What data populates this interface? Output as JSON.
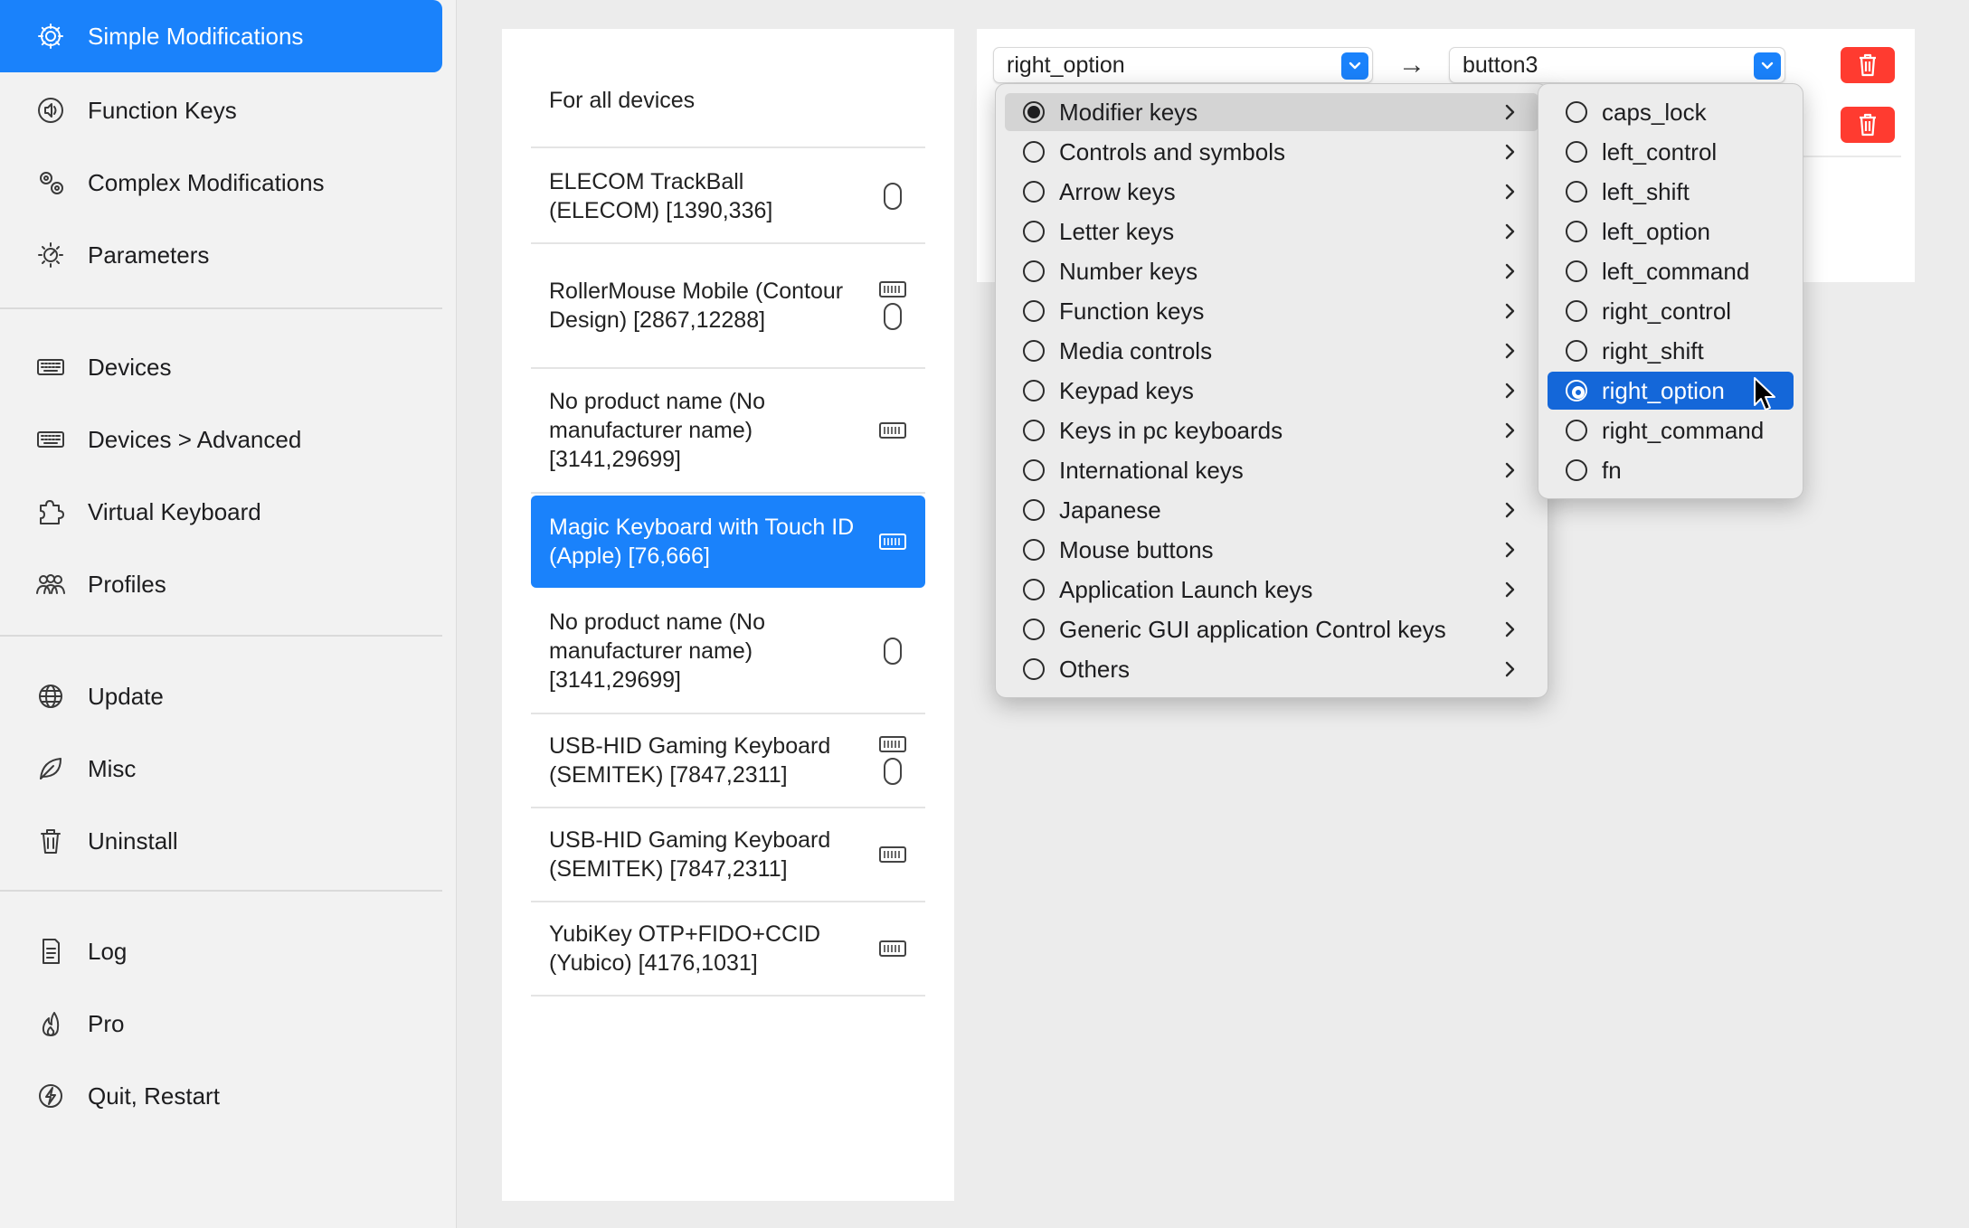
{
  "sidebar": {
    "items": [
      {
        "label": "Simple Modifications",
        "icon": "gear-icon",
        "active": true
      },
      {
        "label": "Function Keys",
        "icon": "speaker-icon"
      },
      {
        "label": "Complex Modifications",
        "icon": "gears-icon"
      },
      {
        "label": "Parameters",
        "icon": "sun-dial-icon"
      },
      {
        "label": "Devices",
        "icon": "keyboard-icon"
      },
      {
        "label": "Devices > Advanced",
        "icon": "keyboard-icon"
      },
      {
        "label": "Virtual Keyboard",
        "icon": "puzzle-icon"
      },
      {
        "label": "Profiles",
        "icon": "people-icon"
      },
      {
        "label": "Update",
        "icon": "globe-icon"
      },
      {
        "label": "Misc",
        "icon": "leaf-icon"
      },
      {
        "label": "Uninstall",
        "icon": "trash-icon"
      },
      {
        "label": "Log",
        "icon": "document-icon"
      },
      {
        "label": "Pro",
        "icon": "flame-icon"
      },
      {
        "label": "Quit, Restart",
        "icon": "bolt-icon"
      }
    ]
  },
  "devices": {
    "items": [
      {
        "name": "For all devices",
        "icons": []
      },
      {
        "name": "ELECOM TrackBall (ELECOM) [1390,336]",
        "icons": [
          "mouse-icon"
        ]
      },
      {
        "name": "RollerMouse Mobile (Contour Design) [2867,12288]",
        "icons": [
          "keyboard-icon",
          "mouse-icon"
        ]
      },
      {
        "name": "No product name (No manufacturer name) [3141,29699]",
        "icons": [
          "keyboard-icon"
        ]
      },
      {
        "name": "Magic Keyboard with Touch ID (Apple) [76,666]",
        "icons": [
          "keyboard-icon"
        ],
        "selected": true
      },
      {
        "name": "No product name (No manufacturer name) [3141,29699]",
        "icons": [
          "mouse-icon"
        ]
      },
      {
        "name": "USB-HID Gaming Keyboard (SEMITEK) [7847,2311]",
        "icons": [
          "keyboard-icon",
          "mouse-icon"
        ]
      },
      {
        "name": "USB-HID Gaming Keyboard (SEMITEK) [7847,2311]",
        "icons": [
          "keyboard-icon"
        ]
      },
      {
        "name": "YubiKey OTP+FIDO+CCID (Yubico) [4176,1031]",
        "icons": [
          "keyboard-icon"
        ]
      }
    ]
  },
  "mapping": {
    "from_value": "right_option",
    "to_value": "button3",
    "arrow": "→"
  },
  "category_menu": {
    "items": [
      {
        "label": "Modifier keys",
        "checked": true,
        "hover": true
      },
      {
        "label": "Controls and symbols"
      },
      {
        "label": "Arrow keys"
      },
      {
        "label": "Letter keys"
      },
      {
        "label": "Number keys"
      },
      {
        "label": "Function keys"
      },
      {
        "label": "Media controls"
      },
      {
        "label": "Keypad keys"
      },
      {
        "label": "Keys in pc keyboards"
      },
      {
        "label": "International keys"
      },
      {
        "label": "Japanese"
      },
      {
        "label": "Mouse buttons"
      },
      {
        "label": "Application Launch keys"
      },
      {
        "label": "Generic GUI application Control keys"
      },
      {
        "label": "Others"
      }
    ]
  },
  "modifier_menu": {
    "items": [
      {
        "label": "caps_lock"
      },
      {
        "label": "left_control"
      },
      {
        "label": "left_shift"
      },
      {
        "label": "left_option"
      },
      {
        "label": "left_command"
      },
      {
        "label": "right_control"
      },
      {
        "label": "right_shift"
      },
      {
        "label": "right_option",
        "checked": true,
        "selected": true
      },
      {
        "label": "right_command"
      },
      {
        "label": "fn"
      }
    ]
  },
  "colors": {
    "accent": "#1a82fb",
    "menu_selected": "#1467d9",
    "danger": "#ff3b30"
  }
}
